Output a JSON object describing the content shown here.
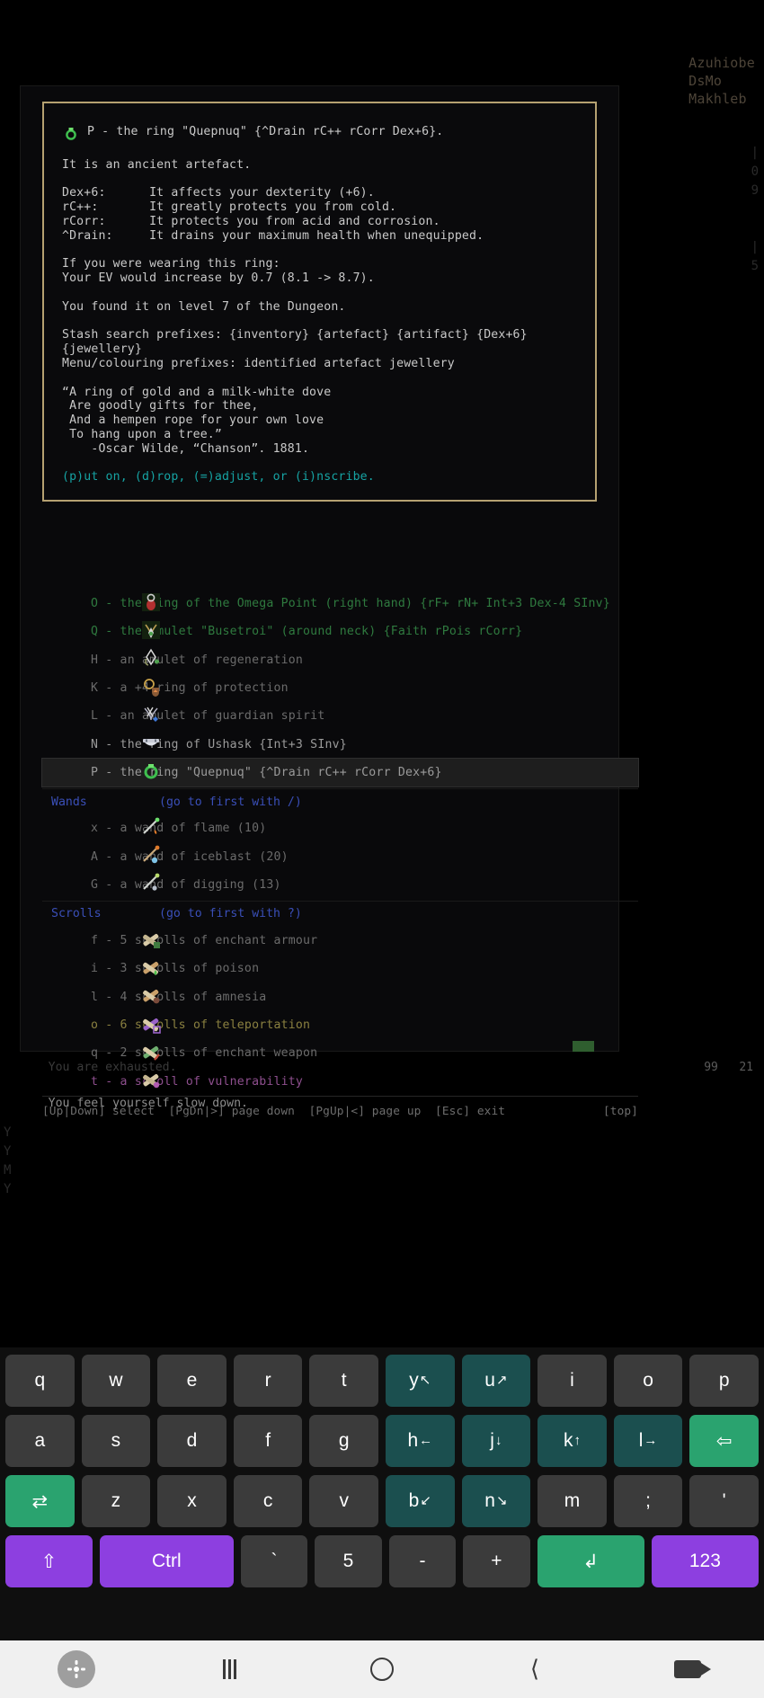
{
  "background_hud": {
    "lines": [
      "Azuhiobe",
      "DsMo",
      "Makhleb"
    ],
    "right_column": [
      "|",
      "0",
      "9",
      "",
      "",
      "",
      "|",
      "5"
    ],
    "left_column": [
      "Y",
      "Y",
      "M",
      "Y"
    ]
  },
  "description": {
    "title_glyph": "ring-icon",
    "title": "P - the ring \"Quepnuq\" {^Drain rC++ rCorr Dex+6}.",
    "lines": [
      "It is an ancient artefact.",
      "",
      "Dex+6:      It affects your dexterity (+6).",
      "rC++:       It greatly protects you from cold.",
      "rCorr:      It protects you from acid and corrosion.",
      "^Drain:     It drains your maximum health when unequipped.",
      "",
      "If you were wearing this ring:",
      "Your EV would increase by 0.7 (8.1 -> 8.7).",
      "",
      "You found it on level 7 of the Dungeon.",
      "",
      "Stash search prefixes: {inventory} {artefact} {artifact} {Dex+6}",
      "{jewellery}",
      "Menu/colouring prefixes: identified artefact jewellery",
      "",
      "“A ring of gold and a milk-white dove",
      " Are goodly gifts for thee,",
      " And a hempen rope for your own love",
      " To hang upon a tree.”",
      "    -Oscar Wilde, “Chanson”. 1881."
    ],
    "prompt": "(p)ut on, (d)rop, (=)adjust, or (i)nscribe."
  },
  "inventory": {
    "items": [
      {
        "icon": "ring-omega-icon",
        "text": "O - the ring of the Omega Point (right hand) {rF+ rN+ Int+3 Dex-4 SInv}",
        "color": "c-green",
        "selected": false
      },
      {
        "icon": "amulet-busetroi-icon",
        "text": "Q - the amulet \"Busetroi\" (around neck) {Faith rPois rCorr}",
        "color": "c-green",
        "selected": false
      },
      {
        "icon": "amulet-regen-icon",
        "text": "H - an amulet of regeneration",
        "color": "c-grey",
        "selected": false
      },
      {
        "icon": "ring-protection-icon",
        "text": "K - a +4 ring of protection",
        "color": "c-grey",
        "selected": false
      },
      {
        "icon": "amulet-guardian-icon",
        "text": "L - an amulet of guardian spirit",
        "color": "c-grey",
        "selected": false
      },
      {
        "icon": "ring-ushask-icon",
        "text": "N - the ring of Ushask {Int+3 SInv}",
        "color": "c-white",
        "selected": false
      },
      {
        "icon": "ring-quepnuq-icon",
        "text": "P - the ring \"Quepnuq\" {^Drain rC++ rCorr Dex+6}",
        "color": "c-white",
        "selected": true
      }
    ],
    "sections": [
      {
        "name": "Wands",
        "hint": "(go to first with /)",
        "items": [
          {
            "icon": "wand-flame-icon",
            "text": "x - a wand of flame (10)",
            "color": "c-grey"
          },
          {
            "icon": "wand-iceblast-icon",
            "text": "A - a wand of iceblast (20)",
            "color": "c-grey"
          },
          {
            "icon": "wand-digging-icon",
            "text": "G - a wand of digging (13)",
            "color": "c-grey"
          }
        ]
      },
      {
        "name": "Scrolls",
        "hint": "(go to first with ?)",
        "items": [
          {
            "icon": "scroll-enchant-armour-icon",
            "text": "f - 5 scrolls of enchant armour",
            "color": "c-grey"
          },
          {
            "icon": "scroll-poison-icon",
            "text": "i - 3 scrolls of poison",
            "color": "c-grey"
          },
          {
            "icon": "scroll-amnesia-icon",
            "text": "l - 4 scrolls of amnesia",
            "color": "c-grey"
          },
          {
            "icon": "scroll-teleportation-icon",
            "text": "o - 6 scrolls of teleportation",
            "color": "c-yellow"
          },
          {
            "icon": "scroll-enchant-weapon-icon",
            "text": "q - 2 scrolls of enchant weapon",
            "color": "c-grey"
          },
          {
            "icon": "scroll-vulnerability-icon",
            "text": "t - a scroll of vulnerability",
            "color": "c-magenta"
          }
        ]
      }
    ]
  },
  "menu_footer": {
    "left": "[Up|Down] select  [PgDn|>] page down  [PgUp|<] page up  [Esc] exit",
    "right": "[top]"
  },
  "messages": {
    "line1": "You are exhausted.",
    "line2": "You feel yourself slow down.",
    "status_right": "99   21"
  },
  "keyboard": {
    "rows": [
      [
        {
          "label": "q",
          "sub": "",
          "style": "dark"
        },
        {
          "label": "w",
          "sub": "",
          "style": "dark"
        },
        {
          "label": "e",
          "sub": "",
          "style": "dark"
        },
        {
          "label": "r",
          "sub": "",
          "style": "dark"
        },
        {
          "label": "t",
          "sub": "",
          "style": "dark"
        },
        {
          "label": "y",
          "sub": "↖",
          "style": "nav"
        },
        {
          "label": "u",
          "sub": "↗",
          "style": "nav"
        },
        {
          "label": "i",
          "sub": "",
          "style": "dark"
        },
        {
          "label": "o",
          "sub": "",
          "style": "dark"
        },
        {
          "label": "p",
          "sub": "",
          "style": "dark"
        }
      ],
      [
        {
          "label": "a",
          "sub": "",
          "style": "dark"
        },
        {
          "label": "s",
          "sub": "",
          "style": "dark"
        },
        {
          "label": "d",
          "sub": "",
          "style": "dark"
        },
        {
          "label": "f",
          "sub": "",
          "style": "dark"
        },
        {
          "label": "g",
          "sub": "",
          "style": "dark"
        },
        {
          "label": "h",
          "sub": "←",
          "style": "nav"
        },
        {
          "label": "j",
          "sub": "↓",
          "style": "nav"
        },
        {
          "label": "k",
          "sub": "↑",
          "style": "nav"
        },
        {
          "label": "l",
          "sub": "→",
          "style": "nav"
        },
        {
          "label": "⇦",
          "sub": "",
          "style": "back"
        }
      ],
      [
        {
          "label": "⇄",
          "sub": "",
          "style": "tab"
        },
        {
          "label": "z",
          "sub": "",
          "style": "dark"
        },
        {
          "label": "x",
          "sub": "",
          "style": "dark"
        },
        {
          "label": "c",
          "sub": "",
          "style": "dark"
        },
        {
          "label": "v",
          "sub": "",
          "style": "dark"
        },
        {
          "label": "b",
          "sub": "↙",
          "style": "nav"
        },
        {
          "label": "n",
          "sub": "↘",
          "style": "nav"
        },
        {
          "label": "m",
          "sub": "",
          "style": "dark"
        },
        {
          "label": ";",
          "sub": "",
          "style": "dark"
        },
        {
          "label": "'",
          "sub": "",
          "style": "dark"
        }
      ],
      [
        {
          "label": "⇧",
          "sub": "",
          "style": "mod"
        },
        {
          "label": "Ctrl",
          "sub": "",
          "style": "mod"
        },
        {
          "label": "`",
          "sub": "",
          "style": "dark"
        },
        {
          "label": "5",
          "sub": "",
          "style": "dark"
        },
        {
          "label": "-",
          "sub": "",
          "style": "dark"
        },
        {
          "label": "+",
          "sub": "",
          "style": "dark"
        },
        {
          "label": "↲",
          "sub": "",
          "style": "enter"
        },
        {
          "label": "123",
          "sub": "",
          "style": "num"
        }
      ]
    ]
  },
  "navbar": {
    "float_button": "accessibility-icon",
    "recents": "recents-icon",
    "home": "home-icon",
    "back": "back-icon",
    "screen_record": "camera-icon"
  }
}
